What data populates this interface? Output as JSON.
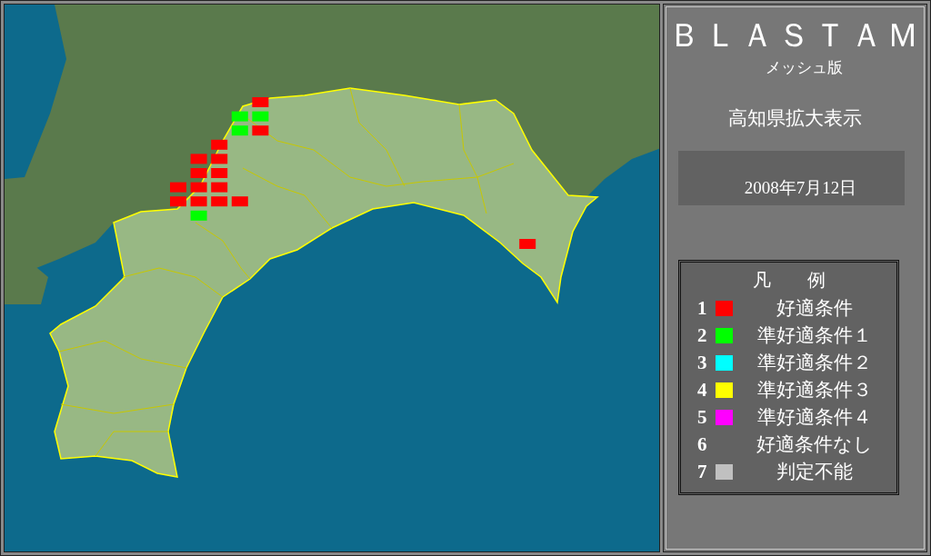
{
  "app": {
    "title": "ＢＬＡＳＴＡＭ",
    "subtitle": "メッシュ版"
  },
  "view": {
    "region": "高知県拡大表示",
    "date": "2008年7月12日"
  },
  "legend": {
    "title": "凡　　例",
    "items": [
      {
        "number": "1",
        "label": "好適条件",
        "color": "#ff0000"
      },
      {
        "number": "2",
        "label": "準好適条件１",
        "color": "#00ff00"
      },
      {
        "number": "3",
        "label": "準好適条件２",
        "color": "#00ffff"
      },
      {
        "number": "4",
        "label": "準好適条件３",
        "color": "#ffff00"
      },
      {
        "number": "5",
        "label": "準好適条件４",
        "color": "#ff00ff"
      },
      {
        "number": "6",
        "label": "好適条件なし"
      },
      {
        "number": "7",
        "label": "判定不能",
        "color": "#c0c0c0"
      }
    ]
  }
}
